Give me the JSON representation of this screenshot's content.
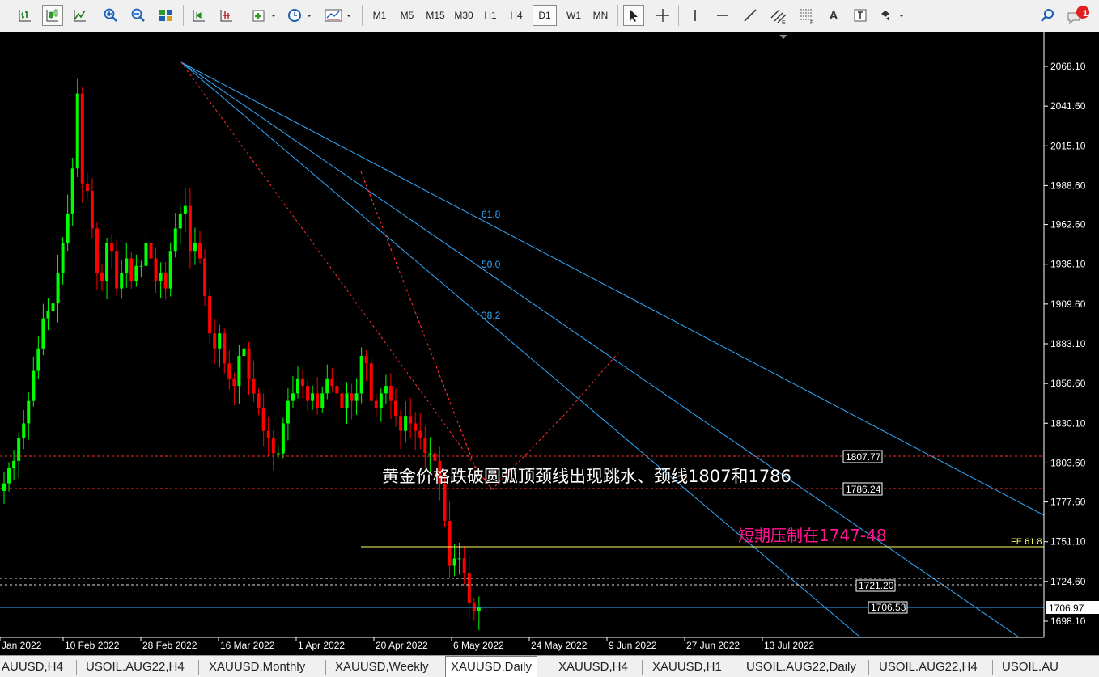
{
  "toolbar": {
    "timeframes": [
      "M1",
      "M5",
      "M15",
      "M30",
      "H1",
      "H4",
      "D1",
      "W1",
      "MN"
    ],
    "active_timeframe": "D1",
    "text_label_tool": "A",
    "notification_count": "1"
  },
  "chart": {
    "symbol": "XAUUSD",
    "period": "Daily",
    "background": "#000000",
    "bull_color": "#00ff00",
    "bear_color": "#ff0000",
    "axis_color": "#ffffff",
    "price_ticks": [
      "2068.10",
      "2041.60",
      "2015.10",
      "1988.60",
      "1962.60",
      "1936.10",
      "1909.60",
      "1883.10",
      "1856.60",
      "1830.10",
      "1803.60",
      "1777.60",
      "1751.10",
      "1724.60",
      "1698.10"
    ],
    "date_ticks": [
      "Jan 2022",
      "10 Feb 2022",
      "28 Feb 2022",
      "16 Mar 2022",
      "1 Apr 2022",
      "20 Apr 2022",
      "6 May 2022",
      "24 May 2022",
      "9 Jun 2022",
      "27 Jun 2022",
      "13 Jul 2022"
    ],
    "current_price": "1706.97",
    "level_labels": {
      "neck1": "1807.77",
      "neck2": "1786.24",
      "level_1721": "1721.20",
      "level_1706": "1706.53",
      "fe": "FE 61.8"
    },
    "fib_fan_labels": [
      "61.8",
      "50.0",
      "38.2"
    ],
    "annotation_main": "黄金价格跌破圆弧顶颈线出现跳水、颈线1807和1786",
    "annotation_resistance": "短期压制在1747-48",
    "annotation_resistance_color": "#ff1493",
    "fan_color": "#33aaff",
    "dashed_red_color": "#ff3030",
    "fe_line_color": "#ffff66"
  },
  "chart_data": {
    "type": "candlestick",
    "title": "XAUUSD,Daily",
    "ylim": [
      1690,
      2085
    ],
    "x": [
      "Jan 2022",
      "10 Feb 2022",
      "28 Feb 2022",
      "16 Mar 2022",
      "1 Apr 2022",
      "20 Apr 2022",
      "6 May 2022",
      "24 May 2022",
      "9 Jun 2022",
      "27 Jun 2022",
      "13 Jul 2022"
    ],
    "key_prices": {
      "high": 2070.4,
      "neckline_upper": 1807.77,
      "neckline_lower": 1786.24,
      "fe_61_8": 1747.5,
      "support": 1721.2,
      "low_line": 1706.53,
      "last": 1706.97
    },
    "series": [
      {
        "name": "XAUUSD",
        "close_path": [
          1790,
          1800,
          1805,
          1820,
          1830,
          1845,
          1865,
          1880,
          1900,
          1905,
          1910,
          1930,
          1950,
          1970,
          2000,
          2050,
          1990,
          1985,
          1960,
          1930,
          1925,
          1950,
          1945,
          1920,
          1930,
          1940,
          1925,
          1935,
          1935,
          1950,
          1940,
          1925,
          1930,
          1920,
          1945,
          1960,
          1970,
          1975,
          1945,
          1950,
          1940,
          1915,
          1890,
          1880,
          1890,
          1870,
          1860,
          1855,
          1875,
          1880,
          1860,
          1850,
          1840,
          1825,
          1820,
          1810,
          1810,
          1830,
          1845,
          1850,
          1860,
          1855,
          1845,
          1850,
          1840,
          1850,
          1860,
          1855,
          1850,
          1840,
          1850,
          1845,
          1850,
          1875,
          1870,
          1845,
          1840,
          1850,
          1855,
          1845,
          1835,
          1825,
          1835,
          1830,
          1825,
          1820,
          1810,
          1810,
          1805,
          1790,
          1765,
          1735,
          1740,
          1740,
          1730,
          1710,
          1705,
          1707
        ]
      }
    ]
  }
}
